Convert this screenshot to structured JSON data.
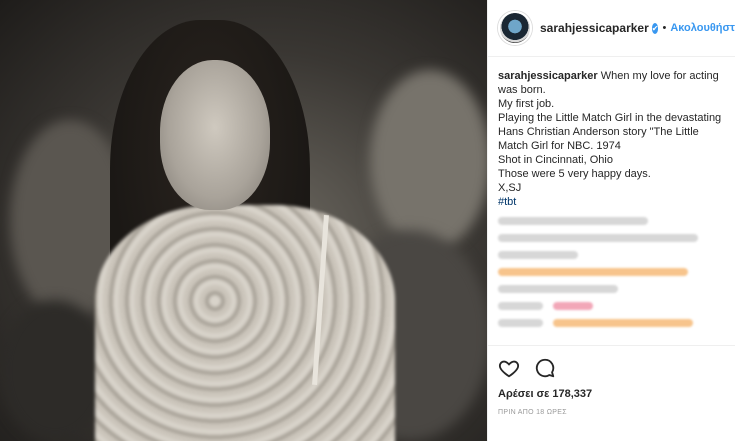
{
  "header": {
    "username": "sarahjessicaparker",
    "verified_mark": "✔",
    "separator": "•",
    "follow_label": "Ακολουθήστε"
  },
  "caption": {
    "username": "sarahjessicaparker",
    "lines": [
      "When my love for acting was born.",
      "My first job.",
      "Playing the Little Match Girl in the devastating Hans Christian Anderson story \"The Little Match Girl for NBC. 1974",
      "Shot in Cincinnati, Ohio",
      "Those were 5 very happy days.",
      "X,SJ"
    ],
    "hashtag": "#tbt"
  },
  "actions": {
    "like_icon": "heart-icon",
    "comment_icon": "comment-icon"
  },
  "likes_text": "Αρέσει σε 178,337",
  "time_text": "ΠΡΙΝ ΑΠΟ 18 ΩΡΕΣ"
}
